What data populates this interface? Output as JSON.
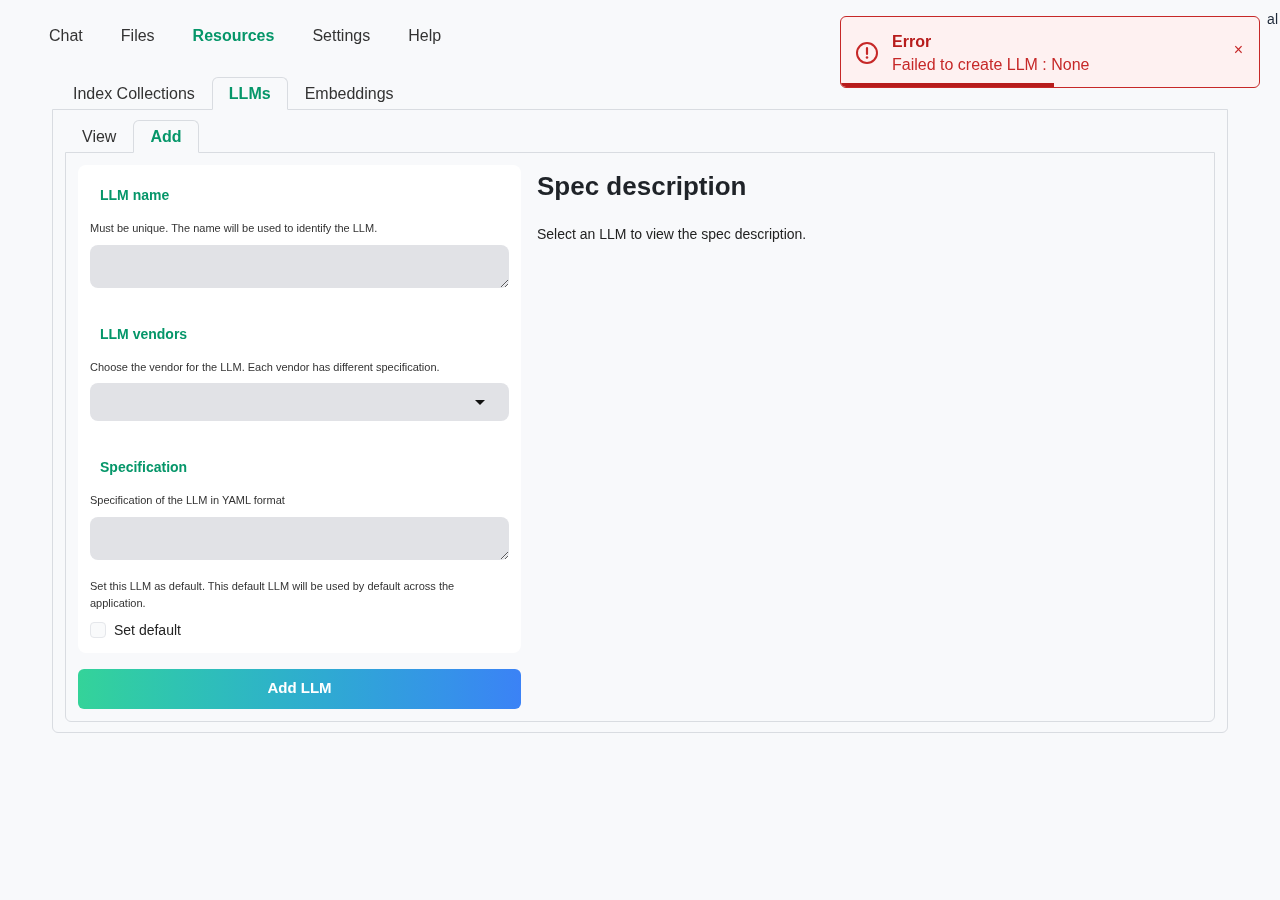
{
  "nav": [
    {
      "label": "Chat",
      "selected": false
    },
    {
      "label": "Files",
      "selected": false
    },
    {
      "label": "Resources",
      "selected": true
    },
    {
      "label": "Settings",
      "selected": false
    },
    {
      "label": "Help",
      "selected": false
    }
  ],
  "corner_text": "al",
  "tabs": [
    {
      "label": "Index Collections",
      "selected": false
    },
    {
      "label": "LLMs",
      "selected": true
    },
    {
      "label": "Embeddings",
      "selected": false
    }
  ],
  "subtabs": [
    {
      "label": "View",
      "selected": false
    },
    {
      "label": "Add",
      "selected": true
    }
  ],
  "form": {
    "fields": [
      {
        "kind": "textarea",
        "label": "LLM name",
        "info": "Must be unique. The name will be used to identify the LLM."
      },
      {
        "kind": "dropdown",
        "label": "LLM vendors",
        "info": "Choose the vendor for the LLM. Each vendor has different specification."
      },
      {
        "kind": "textarea",
        "label": "Specification",
        "info": "Specification of the LLM in YAML format"
      }
    ],
    "default_info": "Set this LLM as default. This default LLM will be used by default across the application.",
    "default_checkbox": {
      "label": "Set default",
      "checked": false
    },
    "submit": "Add LLM"
  },
  "spec": {
    "title": "Spec description",
    "text": "Select an LLM to view the spec description."
  },
  "toast": {
    "title": "Error",
    "message": "Failed to create LLM : None",
    "close": "×",
    "level": 0.51
  }
}
